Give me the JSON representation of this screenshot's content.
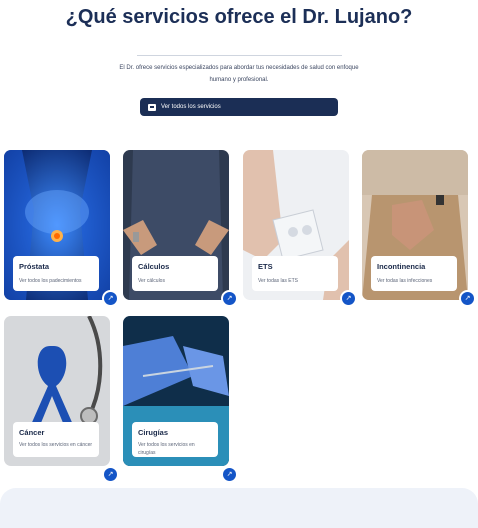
{
  "section": {
    "title": "¿Qué servicios ofrece el Dr. Lujano?",
    "intro": "El Dr. ofrece servicios especializados para abordar tus necesidades de salud con enfoque humano y profesional.",
    "cta_label": "Ver todos los servicios"
  },
  "cards": [
    {
      "name": "Próstata",
      "link": "Ver todos los padecimientos"
    },
    {
      "name": "Cálculos",
      "link": "Ver cálculos"
    },
    {
      "name": "ETS",
      "link": "Ver todas las ETS"
    },
    {
      "name": "Incontinencia",
      "link": "Ver todas las infecciones"
    },
    {
      "name": "Cáncer",
      "link": "Ver todos los servicios en cáncer"
    },
    {
      "name": "Cirugías",
      "link": "Ver todos los servicios en cirugías"
    }
  ],
  "colors": {
    "accent": "#1455c7",
    "navy": "#1b2e55"
  },
  "icons": {
    "cta": "services-icon",
    "card_action": "arrow-up-right-icon"
  }
}
